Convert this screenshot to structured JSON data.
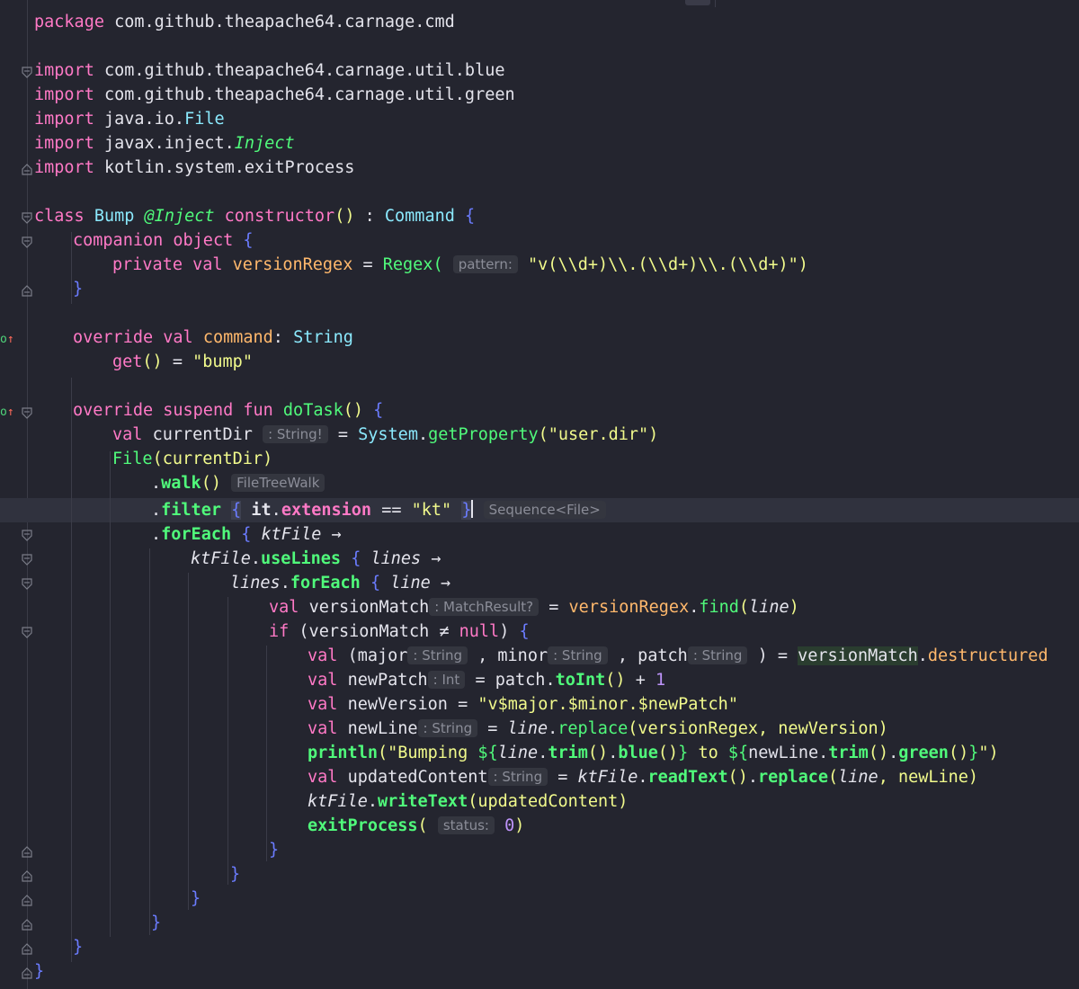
{
  "editor": {
    "language": "kotlin",
    "theme": "dracula",
    "current_line": 21,
    "code": {
      "l1": [
        "package",
        "com.github.theapache64.carnage.cmd"
      ],
      "l3": [
        "import",
        "com.github.theapache64.carnage.util.blue"
      ],
      "l4": [
        "import",
        "com.github.theapache64.carnage.util.green"
      ],
      "l5": [
        "import",
        "java.io.",
        "File"
      ],
      "l6": [
        "import",
        "javax.inject.",
        "Inject"
      ],
      "l7": [
        "import",
        "kotlin.system.exitProcess"
      ],
      "l9": [
        "class",
        "Bump",
        "@Inject",
        "constructor",
        "()",
        ":",
        "Command",
        "{"
      ],
      "l10": [
        "companion",
        "object",
        "{"
      ],
      "l11": [
        "private",
        "val",
        "versionRegex",
        "=",
        "Regex(",
        "pattern:",
        "\"v(\\\\d+)\\\\.(\\\\d+)\\\\.(\\\\d+)\"",
        ")"
      ],
      "l12": [
        "}"
      ],
      "l14": [
        "override",
        "val",
        "command",
        ":",
        "String"
      ],
      "l15": [
        "get",
        "()",
        "=",
        "\"bump\""
      ],
      "l17": [
        "override",
        "suspend",
        "fun",
        "doTask",
        "()",
        "{"
      ],
      "l18": [
        "val",
        "currentDir",
        ": String!",
        "=",
        "System",
        ".",
        "getProperty",
        "(",
        "\"user.dir\"",
        ")"
      ],
      "l19": [
        "File",
        "(currentDir)"
      ],
      "l20": [
        ".",
        "walk",
        "()",
        "FileTreeWalk"
      ],
      "l21": [
        ".",
        "filter",
        "{",
        "it",
        ".",
        "extension",
        "==",
        "\"kt\"",
        "}",
        "Sequence<File>"
      ],
      "l22": [
        ".",
        "forEach",
        "{",
        "ktFile",
        "→"
      ],
      "l23": [
        "ktFile",
        ".",
        "useLines",
        "{",
        "lines",
        "→"
      ],
      "l24": [
        "lines",
        ".",
        "forEach",
        "{",
        "line",
        "→"
      ],
      "l25": [
        "val",
        "versionMatch",
        ": MatchResult?",
        "=",
        "versionRegex",
        ".",
        "find",
        "(",
        "line",
        ")"
      ],
      "l26": [
        "if",
        "(versionMatch",
        "≠",
        "null",
        ")",
        "{"
      ],
      "l27": [
        "val",
        "(major",
        ": String",
        ",",
        "minor",
        ": String",
        ",",
        "patch",
        ": String",
        ")",
        "=",
        "versionMatch",
        ".",
        "destructured"
      ],
      "l28": [
        "val",
        "newPatch",
        ": Int",
        "=",
        "patch",
        ".",
        "toInt",
        "()",
        "+",
        "1"
      ],
      "l29": [
        "val",
        "newVersion",
        "=",
        "\"v$major.$minor.$newPatch\""
      ],
      "l30": [
        "val",
        "newLine",
        ": String",
        "=",
        "line",
        ".",
        "replace",
        "(versionRegex, newVersion)"
      ],
      "l31": [
        "println",
        "(",
        "\"Bumping ",
        "${",
        "line",
        ".",
        "trim",
        "()",
        ".",
        "blue",
        "()",
        "}",
        " to ",
        "${",
        "newLine",
        ".",
        "trim",
        "()",
        ".",
        "green",
        "()",
        "}",
        "\")"
      ],
      "l32": [
        "val",
        "updatedContent",
        ": String",
        "=",
        "ktFile",
        ".",
        "readText",
        "()",
        ".",
        "replace",
        "(",
        "line",
        ", newLine)"
      ],
      "l33": [
        "ktFile",
        ".",
        "writeText",
        "(updatedContent)"
      ],
      "l34": [
        "exitProcess",
        "(",
        "status:",
        "0",
        ")"
      ],
      "l35": [
        "}"
      ],
      "l36": [
        "}"
      ],
      "l37": [
        "}"
      ],
      "l38": [
        "}"
      ],
      "l39": [
        "}"
      ],
      "l40": [
        "}"
      ]
    }
  }
}
